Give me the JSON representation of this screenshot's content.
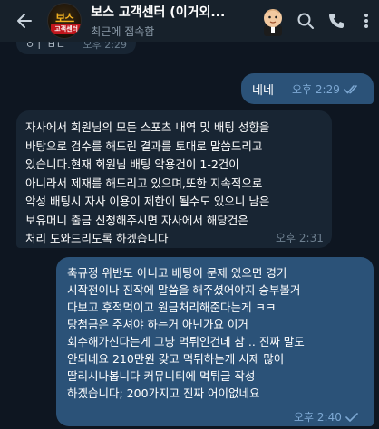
{
  "header": {
    "title": "보스 고객센터 (이거외...",
    "subtitle": "최근에 접속함",
    "logo_top": "보스",
    "logo_bottom": "고객센터"
  },
  "colors": {
    "background": "#0e1621",
    "header": "#17212b",
    "incoming_bubble": "#182533",
    "outgoing_bubble": "#2b5278",
    "outgoing_meta": "#7da8d3"
  },
  "messages": [
    {
      "direction": "in",
      "partial": true,
      "text": "ㅇㅣ ㅂㄴ",
      "time": "오후 2:29"
    },
    {
      "direction": "out",
      "text": "네네",
      "time": "오후 2:29",
      "status": "read"
    },
    {
      "direction": "in",
      "text": "자사에서 회원님의 모든 스포츠 내역 및 배팅 성향을\n바탕으로 검수를 해드린 결과를 토대로 말씀드리고\n있습니다.현재 회원님 배팅 악용건이 1-2건이\n아니라서 제재를 해드리고 있으며,또한 지속적으로\n악성 배팅시 자사 이용이 제한이 될수도 있으니 남은\n보유머니 출금 신청해주시면 자사에서 해당건은\n처리 도와드리도록 하겠습니다",
      "time": "오후 2:31"
    },
    {
      "direction": "out",
      "text": "축규정 위반도 아니고 배팅이 문제 있으면 경기\n시작전이나 진작에 말씀을 해주셨어야지 승부볼거\n다보고 후적먹이고 원금처리해준다는게 ㅋㅋ\n당첨금은 주셔야 하는거 아닌가요 이거\n회수해가신다는게 그냥 먹튀인건데 참 .. 진짜 말도\n안되네요 210만원 갖고 먹튀하는게 시제 많이\n딸리시나봅니다 커뮤니티에 먹튀글 작성\n하겠습니다; 200가지고 진짜 어이없네요",
      "time": "오후 2:40",
      "status": "sent"
    }
  ]
}
